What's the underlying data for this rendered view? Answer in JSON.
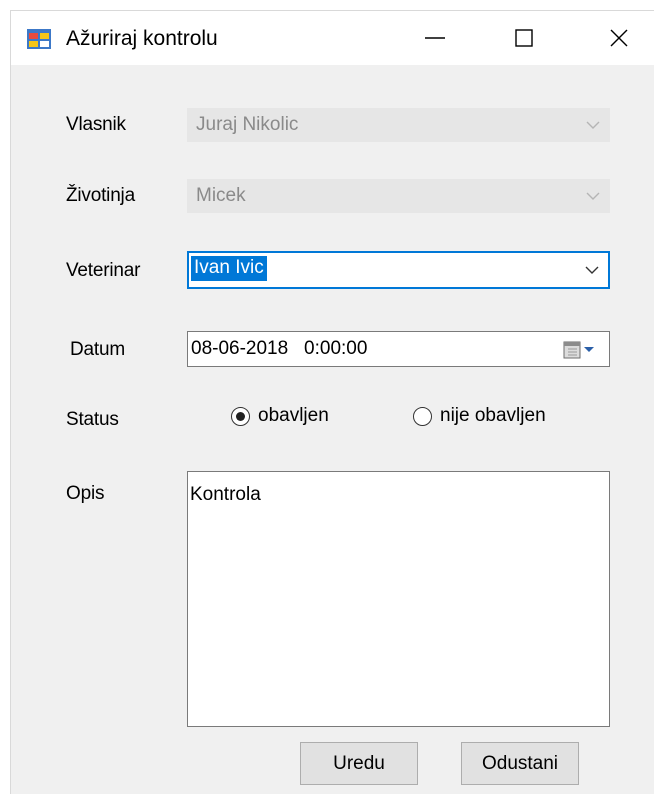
{
  "window": {
    "title": "Ažuriraj kontrolu",
    "icons": {
      "app": "form-app-icon",
      "minimize": "minimize-icon",
      "maximize": "maximize-icon",
      "close": "close-icon"
    }
  },
  "form": {
    "owner": {
      "label": "Vlasnik",
      "value": "Juraj Nikolic",
      "enabled": false
    },
    "animal": {
      "label": "Životinja",
      "value": "Micek",
      "enabled": false
    },
    "vet": {
      "label": "Veterinar",
      "value": "Ivan Ivic",
      "enabled": true
    },
    "date": {
      "label": "Datum",
      "value": "08-06-2018   0:00:00"
    },
    "status": {
      "label": "Status",
      "options": [
        {
          "label": "obavljen",
          "checked": true
        },
        {
          "label": "nije obavljen",
          "checked": false
        }
      ]
    },
    "description": {
      "label": "Opis",
      "value": "Kontrola"
    }
  },
  "buttons": {
    "ok": "Uredu",
    "cancel": "Odustani"
  },
  "colors": {
    "accent": "#0078d7",
    "disabled_bg": "#e6e6e6",
    "window_bg": "#f0f0f0"
  }
}
